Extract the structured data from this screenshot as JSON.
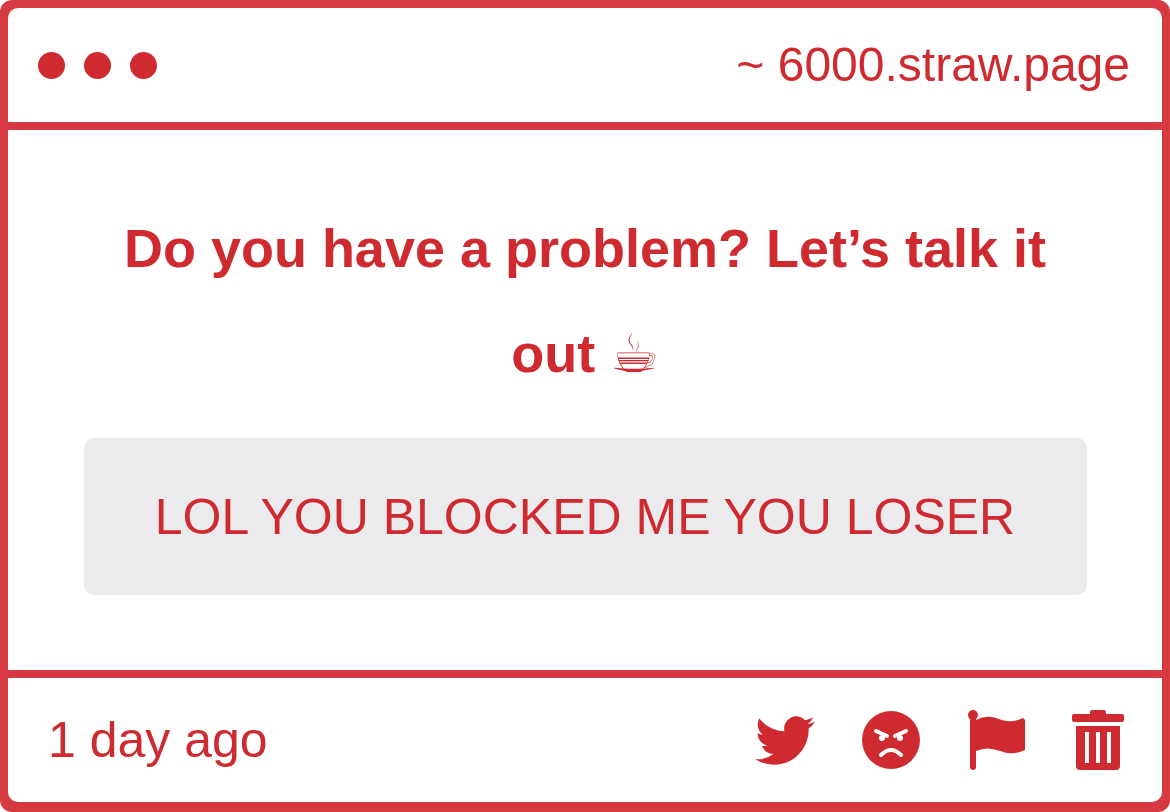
{
  "window": {
    "address": "~ 6000.straw.page"
  },
  "prompt": {
    "text": "Do you have a problem? Let’s talk it out ☕"
  },
  "message": {
    "text": "LOL YOU BLOCKED ME YOU LOSER"
  },
  "footer": {
    "time": "1 day ago"
  }
}
